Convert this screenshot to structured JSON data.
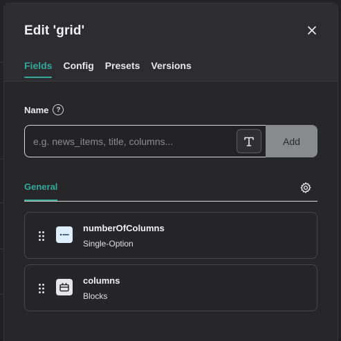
{
  "modal": {
    "title": "Edit 'grid'",
    "tabs": [
      {
        "label": "Fields",
        "active": true
      },
      {
        "label": "Config",
        "active": false
      },
      {
        "label": "Presets",
        "active": false
      },
      {
        "label": "Versions",
        "active": false
      }
    ]
  },
  "name_field": {
    "label": "Name",
    "placeholder": "e.g. news_items, title, columns...",
    "value": "",
    "add_label": "Add"
  },
  "section": {
    "label": "General"
  },
  "fields": [
    {
      "name": "numberOfColumns",
      "type": "Single-Option",
      "icon": "single-option-icon"
    },
    {
      "name": "columns",
      "type": "Blocks",
      "icon": "blocks-icon"
    }
  ],
  "colors": {
    "accent": "#35a99c",
    "modal_bg": "#27272a",
    "add_button": "#898a8d"
  }
}
